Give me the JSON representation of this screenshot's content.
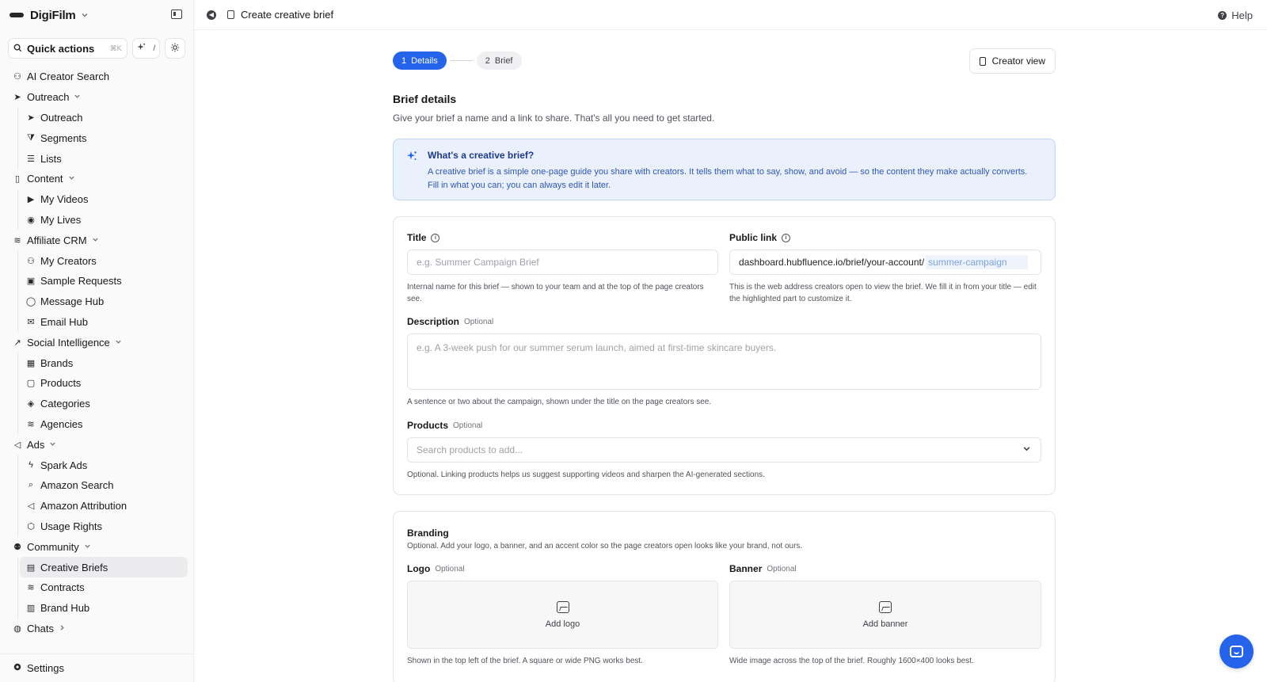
{
  "sidebar": {
    "brand": "DigiFilm",
    "quick_actions": {
      "label": "Quick actions",
      "shortcut": "⌘K",
      "slash": "/"
    },
    "items": [
      {
        "label": "AI Creator Search",
        "icon": "user-search-icon",
        "level": 0
      },
      {
        "label": "Outreach",
        "icon": "send-icon",
        "level": 0,
        "expandable": true
      },
      {
        "label": "Outreach",
        "icon": "send-icon",
        "level": 1
      },
      {
        "label": "Segments",
        "icon": "filter-icon",
        "level": 1
      },
      {
        "label": "Lists",
        "icon": "list-icon",
        "level": 1
      },
      {
        "label": "Content",
        "icon": "columns-icon",
        "level": 0,
        "expandable": true
      },
      {
        "label": "My Videos",
        "icon": "video-icon",
        "level": 1
      },
      {
        "label": "My Lives",
        "icon": "broadcast-icon",
        "level": 1
      },
      {
        "label": "Affiliate CRM",
        "icon": "layers-icon",
        "level": 0,
        "expandable": true
      },
      {
        "label": "My Creators",
        "icon": "users-icon",
        "level": 1
      },
      {
        "label": "Sample Requests",
        "icon": "gift-icon",
        "level": 1
      },
      {
        "label": "Message Hub",
        "icon": "message-icon",
        "level": 1
      },
      {
        "label": "Email Hub",
        "icon": "mail-icon",
        "level": 1
      },
      {
        "label": "Social Intelligence",
        "icon": "trend-icon",
        "level": 0,
        "expandable": true
      },
      {
        "label": "Brands",
        "icon": "store-icon",
        "level": 1
      },
      {
        "label": "Products",
        "icon": "package-icon",
        "level": 1
      },
      {
        "label": "Categories",
        "icon": "stack-icon",
        "level": 1
      },
      {
        "label": "Agencies",
        "icon": "layers-icon",
        "level": 1
      },
      {
        "label": "Ads",
        "icon": "megaphone-icon",
        "level": 0,
        "expandable": true
      },
      {
        "label": "Spark Ads",
        "icon": "bolt-icon",
        "level": 1
      },
      {
        "label": "Amazon Search",
        "icon": "search-icon",
        "level": 1
      },
      {
        "label": "Amazon Attribution",
        "icon": "megaphone-icon",
        "level": 1
      },
      {
        "label": "Usage Rights",
        "icon": "shield-icon",
        "level": 1
      },
      {
        "label": "Community",
        "icon": "community-icon",
        "level": 0,
        "expandable": true
      },
      {
        "label": "Creative Briefs",
        "icon": "clipboard-icon",
        "level": 1,
        "active": true
      },
      {
        "label": "Contracts",
        "icon": "layers-icon",
        "level": 1
      },
      {
        "label": "Brand Hub",
        "icon": "database-icon",
        "level": 1
      },
      {
        "label": "Chats",
        "icon": "chat-icon",
        "level": 0,
        "expandable": true,
        "collapsed": true
      }
    ],
    "settings_label": "Settings"
  },
  "topbar": {
    "title": "Create creative brief",
    "help_label": "Help"
  },
  "stepper": {
    "step1_num": "1",
    "step1_label": "Details",
    "step2_num": "2",
    "step2_label": "Brief"
  },
  "creator_view_label": "Creator view",
  "section": {
    "title": "Brief details",
    "subtitle": "Give your brief a name and a link to share. That's all you need to get started."
  },
  "info": {
    "title": "What's a creative brief?",
    "line1": "A creative brief is a simple one-page guide you share with creators. It tells them what to say, show, and avoid — so the content they make actually converts.",
    "line2": "Fill in what you can; you can always edit it later."
  },
  "form": {
    "title_label": "Title",
    "title_placeholder": "e.g. Summer Campaign Brief",
    "title_hint": "Internal name for this brief — shown to your team and at the top of the page creators see.",
    "link_label": "Public link",
    "link_prefix": "dashboard.hubfluence.io/brief/your-account/",
    "link_slug": "summer-campaign",
    "link_hint": "This is the web address creators open to view the brief. We fill it in from your title — edit the highlighted part to customize it.",
    "desc_label": "Description",
    "optional": "Optional",
    "desc_placeholder": "e.g. A 3-week push for our summer serum launch, aimed at first-time skincare buyers.",
    "desc_hint": "A sentence or two about the campaign, shown under the title on the page creators see.",
    "products_label": "Products",
    "products_placeholder": "Search products to add...",
    "products_hint": "Optional. Linking products helps us suggest supporting videos and sharpen the AI-generated sections."
  },
  "branding": {
    "title": "Branding",
    "subtitle": "Optional. Add your logo, a banner, and an accent color so the page creators open looks like your brand, not ours.",
    "logo_label": "Logo",
    "logo_button": "Add logo",
    "logo_hint": "Shown in the top left of the brief. A square or wide PNG works best.",
    "banner_label": "Banner",
    "banner_button": "Add banner",
    "banner_hint": "Wide image across the top of the brief. Roughly 1600×400 looks best."
  },
  "colors": {
    "accent": "#2563eb",
    "info_bg": "#eaf1fd"
  }
}
